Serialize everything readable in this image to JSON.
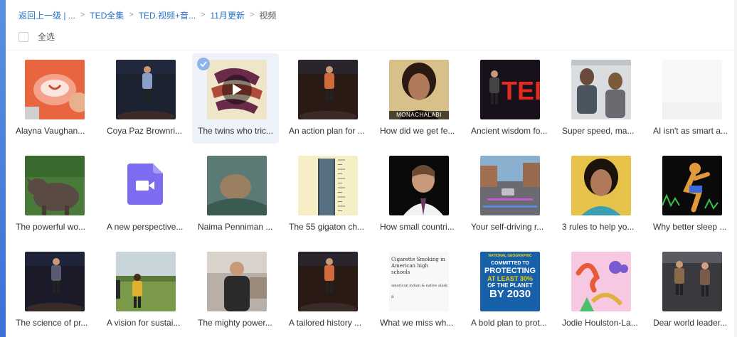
{
  "breadcrumb": {
    "items": [
      "返回上一级 | ...",
      "TED全集",
      "TED.视频+音...",
      "11月更新"
    ],
    "current": "视频",
    "separator": ">"
  },
  "select_all_label": "全选",
  "colors": {
    "link": "#2a73c9",
    "selected_bg": "#eef3fb",
    "badge": "#8db4ee",
    "file_icon": "#7b6cf0"
  },
  "videos": [
    {
      "title": "Alayna Vaughan...",
      "thumb": "mouth-closeup-icon"
    },
    {
      "title": "Coya Paz Brownri...",
      "thumb": "speaker-on-stage-icon"
    },
    {
      "title": "The twins who tric...",
      "thumb": "twins-illustration-icon",
      "selected": true
    },
    {
      "title": "An action plan for ...",
      "thumb": "speaker-on-stage-icon"
    },
    {
      "title": "How did we get fe...",
      "thumb": "portrait-icon",
      "watermark": "MONACHALABI"
    },
    {
      "title": "Ancient wisdom fo...",
      "thumb": "ted-stage-icon"
    },
    {
      "title": "Super speed, ma...",
      "thumb": "astronauts-icon"
    },
    {
      "title": "AI isn't as smart a...",
      "thumb": "blank-thumb-icon"
    },
    {
      "title": "The powerful wo...",
      "thumb": "rhino-icon"
    },
    {
      "title": "A new perspective...",
      "thumb": "video-file-icon"
    },
    {
      "title": "Naima Penniman ...",
      "thumb": "nature-scene-icon"
    },
    {
      "title": "The 55 gigaton ch...",
      "thumb": "measurement-chart-icon"
    },
    {
      "title": "How small countri...",
      "thumb": "speaker-portrait-icon"
    },
    {
      "title": "Your self-driving r...",
      "thumb": "street-scene-icon"
    },
    {
      "title": "3 rules to help yo...",
      "thumb": "portrait-icon"
    },
    {
      "title": "Why better sleep ...",
      "thumb": "dancing-figure-icon"
    },
    {
      "title": "The science of pr...",
      "thumb": "speaker-on-stage-icon"
    },
    {
      "title": "A vision for sustai...",
      "thumb": "field-scene-icon"
    },
    {
      "title": "The mighty power...",
      "thumb": "speaker-kitchen-icon"
    },
    {
      "title": "A tailored history ...",
      "thumb": "speaker-on-stage-icon"
    },
    {
      "title": "What we miss wh...",
      "thumb": "handwritten-note-icon",
      "note_lines": [
        "Cigarette Smoking in",
        "American high schools",
        "american indian & native alask",
        "a"
      ]
    },
    {
      "title": "A bold plan to prot...",
      "thumb": "ocean-poster-icon",
      "poster_lines": [
        "NATIONAL GEOGRAPHIC",
        "COMMITTED TO",
        "PROTECTING",
        "AT LEAST 30%",
        "OF THE PLANET",
        "BY 2030"
      ]
    },
    {
      "title": "Jodie Houlston-La...",
      "thumb": "colorful-illustration-icon"
    },
    {
      "title": "Dear world leader...",
      "thumb": "two-speakers-icon"
    }
  ]
}
